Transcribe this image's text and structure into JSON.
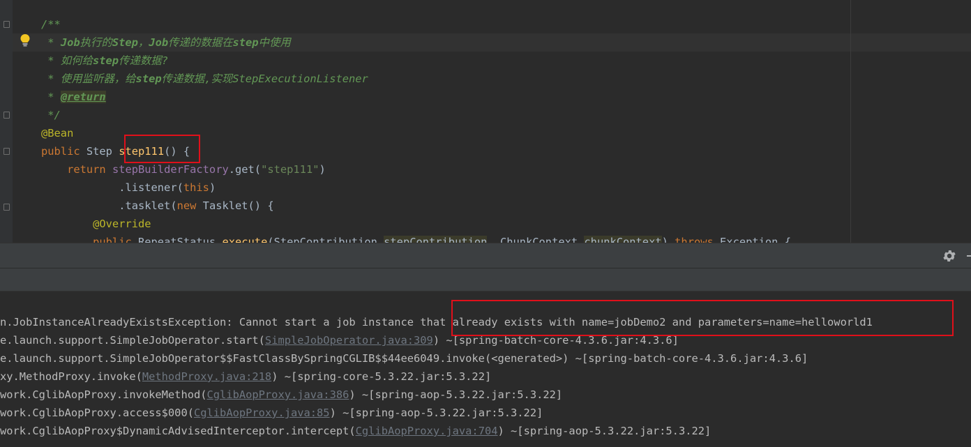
{
  "editor": {
    "lines": [
      {
        "tokens": [
          {
            "c": "doc",
            "t": "/**"
          }
        ]
      },
      {
        "tokens": [
          {
            "c": "doc",
            "t": " * "
          },
          {
            "c": "docb",
            "t": "Job"
          },
          {
            "c": "doc",
            "t": "执行的"
          },
          {
            "c": "docb",
            "t": "Step"
          },
          {
            "c": "doc",
            "t": "，"
          },
          {
            "c": "docb",
            "t": "Job"
          },
          {
            "c": "doc",
            "t": "传递的数据在"
          },
          {
            "c": "docb",
            "t": "step"
          },
          {
            "c": "doc",
            "t": "中使用"
          }
        ]
      },
      {
        "tokens": [
          {
            "c": "doc",
            "t": " * 如何给"
          },
          {
            "c": "docb",
            "t": "step"
          },
          {
            "c": "doc",
            "t": "传递数据?"
          }
        ]
      },
      {
        "tokens": [
          {
            "c": "doc",
            "t": " * 使用监听器，给"
          },
          {
            "c": "docb",
            "t": "step"
          },
          {
            "c": "doc",
            "t": "传递数据,实现StepExecutionListener"
          }
        ]
      },
      {
        "tokens": [
          {
            "c": "doc",
            "t": " * "
          },
          {
            "c": "tag",
            "t": "@return"
          }
        ]
      },
      {
        "tokens": [
          {
            "c": "doc",
            "t": " */"
          }
        ]
      },
      {
        "tokens": [
          {
            "c": "ann",
            "t": "@Bean"
          }
        ]
      },
      {
        "tokens": [
          {
            "c": "kw",
            "t": "public "
          },
          {
            "c": "plain",
            "t": "Step "
          },
          {
            "c": "fn",
            "t": "step111"
          },
          {
            "c": "plain",
            "t": "() {"
          }
        ]
      },
      {
        "tokens": [
          {
            "c": "kw",
            "t": "    return "
          },
          {
            "c": "fld",
            "t": "stepBuilderFactory"
          },
          {
            "c": "plain",
            "t": ".get("
          },
          {
            "c": "str",
            "t": "\"step111\""
          },
          {
            "c": "plain",
            "t": ")"
          }
        ]
      },
      {
        "tokens": [
          {
            "c": "plain",
            "t": "            .listener("
          },
          {
            "c": "kw",
            "t": "this"
          },
          {
            "c": "plain",
            "t": ")"
          }
        ]
      },
      {
        "tokens": [
          {
            "c": "plain",
            "t": "            .tasklet("
          },
          {
            "c": "kw",
            "t": "new "
          },
          {
            "c": "plain",
            "t": "Tasklet() {"
          }
        ]
      },
      {
        "tokens": [
          {
            "c": "ann",
            "t": "        @Override"
          }
        ]
      },
      {
        "tokens": [
          {
            "c": "kw",
            "t": "        public "
          },
          {
            "c": "plain",
            "t": "RepeatStatus "
          },
          {
            "c": "fn",
            "t": "execute"
          },
          {
            "c": "plain",
            "t": "(StepContribution "
          },
          {
            "c": "hl",
            "t": "stepContribution"
          },
          {
            "c": "plain",
            "t": ", ChunkContext "
          },
          {
            "c": "hl",
            "t": "chunkContext"
          },
          {
            "c": "plain",
            "t": ") "
          },
          {
            "c": "kw",
            "t": "throws "
          },
          {
            "c": "plain",
            "t": "Exception {"
          }
        ]
      }
    ]
  },
  "console": {
    "lines": [
      {
        "tokens": [
          {
            "c": "p",
            "t": "n.JobInstanceAlreadyExistsException: Cannot start a job instance that already exists with name=jobDemo2 and parameters=name=helloworld1"
          }
        ]
      },
      {
        "tokens": [
          {
            "c": "p",
            "t": "e.launch.support.SimpleJobOperator.start("
          },
          {
            "c": "link",
            "t": "SimpleJobOperator.java:309"
          },
          {
            "c": "p",
            "t": ") ~[spring-batch-core-4.3.6.jar:4.3.6]"
          }
        ]
      },
      {
        "tokens": [
          {
            "c": "p",
            "t": "e.launch.support.SimpleJobOperator$$FastClassBySpringCGLIB$$44ee6049.invoke(<generated>) ~[spring-batch-core-4.3.6.jar:4.3.6]"
          }
        ]
      },
      {
        "tokens": [
          {
            "c": "p",
            "t": "xy.MethodProxy.invoke("
          },
          {
            "c": "link",
            "t": "MethodProxy.java:218"
          },
          {
            "c": "p",
            "t": ") ~[spring-core-5.3.22.jar:5.3.22]"
          }
        ]
      },
      {
        "tokens": [
          {
            "c": "p",
            "t": "work.CglibAopProxy.invokeMethod("
          },
          {
            "c": "link",
            "t": "CglibAopProxy.java:386"
          },
          {
            "c": "p",
            "t": ") ~[spring-aop-5.3.22.jar:5.3.22]"
          }
        ]
      },
      {
        "tokens": [
          {
            "c": "p",
            "t": "work.CglibAopProxy.access$000("
          },
          {
            "c": "link",
            "t": "CglibAopProxy.java:85"
          },
          {
            "c": "p",
            "t": ") ~[spring-aop-5.3.22.jar:5.3.22]"
          }
        ]
      },
      {
        "tokens": [
          {
            "c": "p",
            "t": "work.CglibAopProxy$DynamicAdvisedInterceptor.intercept("
          },
          {
            "c": "link",
            "t": "CglibAopProxy.java:704"
          },
          {
            "c": "p",
            "t": ") ~[spring-aop-5.3.22.jar:5.3.22]"
          }
        ]
      }
    ]
  },
  "icons": {
    "settings": "gear-icon",
    "hide": "minimize-icon",
    "intention": "lightbulb-icon"
  },
  "colors": {
    "highlight_box": "#e0101a",
    "comment": "#629755",
    "keyword": "#cc7832",
    "function": "#ffc66d"
  }
}
